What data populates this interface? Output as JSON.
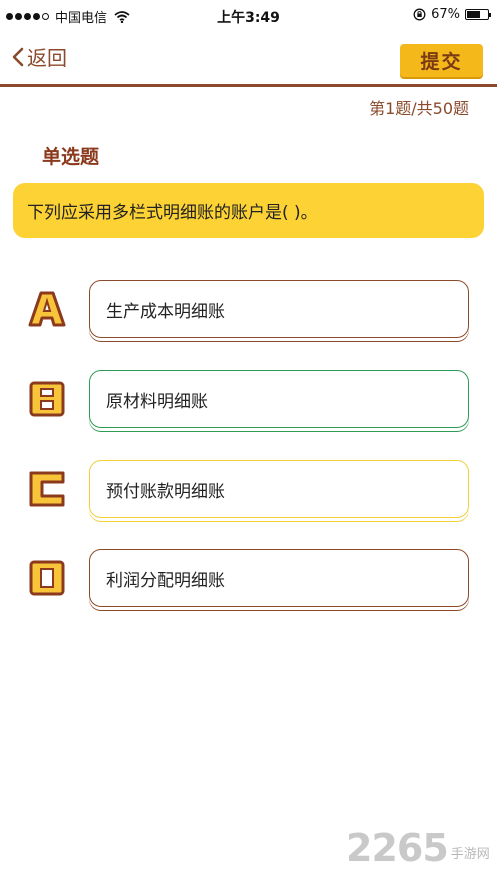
{
  "status_bar": {
    "carrier": "中国电信",
    "time": "上午3:49",
    "battery": "67%",
    "battery_level": 0.67
  },
  "nav": {
    "back_label": "返回",
    "submit_label": "提交"
  },
  "progress": "第1题/共50题",
  "question_type": "单选题",
  "question_text": "下列应采用多栏式明细账的账户是( )。",
  "options": [
    {
      "letter": "A",
      "text": "生产成本明细账",
      "color": "#8b4a2b"
    },
    {
      "letter": "B",
      "text": "原材料明细账",
      "color": "#2d9a55"
    },
    {
      "letter": "C",
      "text": "预付账款明细账",
      "color": "#f3cf3a"
    },
    {
      "letter": "D",
      "text": "利润分配明细账",
      "color": "#8b4a2b"
    }
  ],
  "watermark": {
    "number": "2265",
    "text": "手游网"
  },
  "colors": {
    "accent_brown": "#8b4a2b",
    "accent_yellow": "#fdd235",
    "button_yellow": "#f5b81b"
  }
}
